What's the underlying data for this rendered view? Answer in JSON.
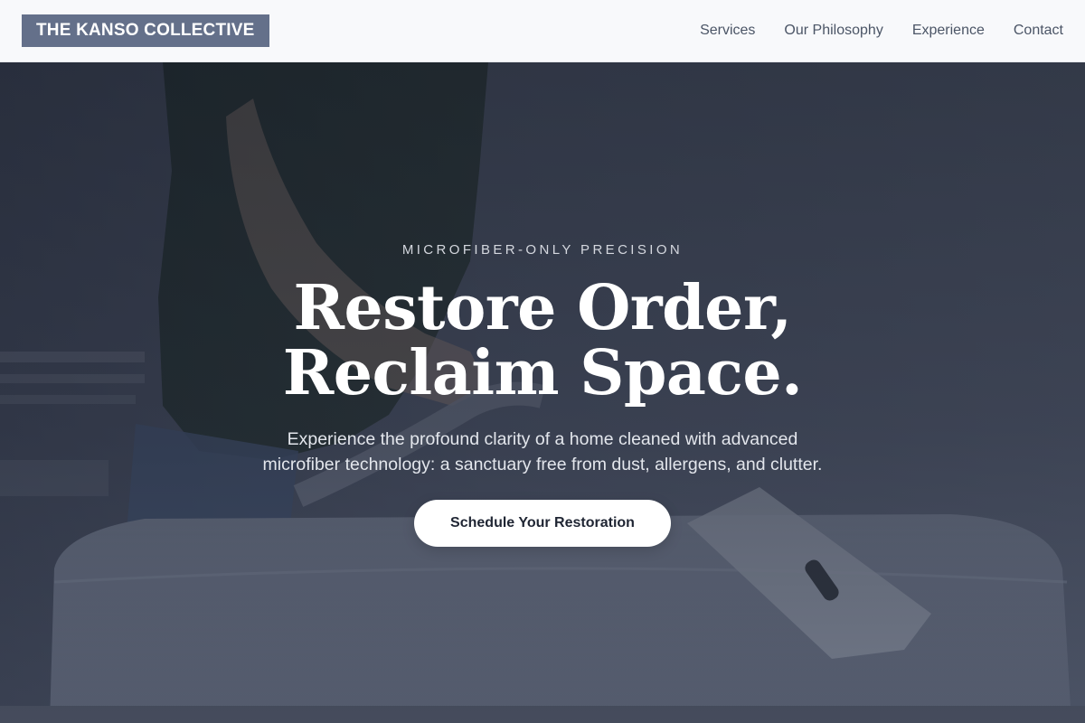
{
  "header": {
    "logo_text": "THE KANSO COLLECTIVE",
    "nav": [
      {
        "label": "Services"
      },
      {
        "label": "Our Philosophy"
      },
      {
        "label": "Experience"
      },
      {
        "label": "Contact"
      }
    ]
  },
  "hero": {
    "eyebrow": "MICROFIBER-ONLY PRECISION",
    "headline_line1": "Restore Order,",
    "headline_line2": "Reclaim Space.",
    "subcopy_line1": "Experience the profound clarity of a home cleaned with advanced",
    "subcopy_line2": "microfiber technology: a sanctuary free from dust, allergens, and clutter.",
    "cta_label": "Schedule Your Restoration",
    "background_description_icon": "person-vacuuming-upholstery-photo"
  },
  "colors": {
    "header_bg": "#f8f9fb",
    "logo_bg": "#64708a",
    "nav_text": "#4b5566",
    "hero_overlay": "#2a3042",
    "cta_bg": "#ffffff",
    "cta_text": "#1f2533"
  }
}
